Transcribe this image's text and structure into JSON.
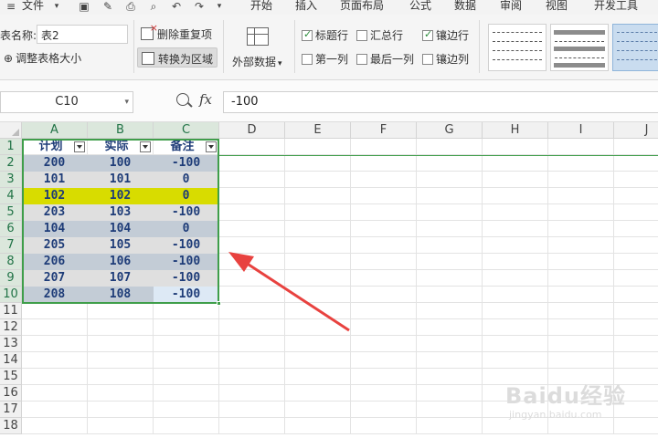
{
  "menubar": {
    "file_menu": "文件",
    "tabs": [
      "开始",
      "插入",
      "页面布局",
      "公式",
      "数据",
      "审阅",
      "视图",
      "开发工具"
    ]
  },
  "ribbon": {
    "table_name_label": "表名称:",
    "table_name_value": "表2",
    "resize_table": "调整表格大小",
    "remove_duplicates": "删除重复项",
    "convert_to_range": "转换为区域",
    "external_data": "外部数据",
    "options": [
      {
        "label": "标题行",
        "checked": true
      },
      {
        "label": "汇总行",
        "checked": false
      },
      {
        "label": "镶边行",
        "checked": true
      },
      {
        "label": "第一列",
        "checked": false
      },
      {
        "label": "最后一列",
        "checked": false
      },
      {
        "label": "镶边列",
        "checked": false
      }
    ]
  },
  "formula_bar": {
    "name_box": "C10",
    "fx_label": "fx",
    "formula": "-100"
  },
  "sheet": {
    "columns": [
      "A",
      "B",
      "C",
      "D",
      "E",
      "F",
      "G",
      "H",
      "I",
      "J"
    ],
    "rows": [
      "1",
      "2",
      "3",
      "4",
      "5",
      "6",
      "7",
      "8",
      "9",
      "10",
      "11",
      "12",
      "13",
      "14",
      "15",
      "16",
      "17",
      "18"
    ],
    "table_headers": [
      "计划",
      "实际",
      "备注"
    ],
    "table_rows": [
      [
        "200",
        "100",
        "-100"
      ],
      [
        "101",
        "101",
        "0"
      ],
      [
        "102",
        "102",
        "0"
      ],
      [
        "203",
        "103",
        "-100"
      ],
      [
        "104",
        "104",
        "0"
      ],
      [
        "205",
        "105",
        "-100"
      ],
      [
        "206",
        "106",
        "-100"
      ],
      [
        "207",
        "107",
        "-100"
      ],
      [
        "208",
        "108",
        "-100"
      ]
    ],
    "colors": {
      "band_dark": "#c3ccd6",
      "band_light": "#dfdfdf",
      "highlight_row": "#d8dc00",
      "active_cell": "#dde9f5",
      "table_border": "#3f9e4a",
      "arrow": "#e8423f"
    }
  },
  "watermark": {
    "main": "Baidu经验",
    "sub": "jingyan.baidu.com"
  }
}
